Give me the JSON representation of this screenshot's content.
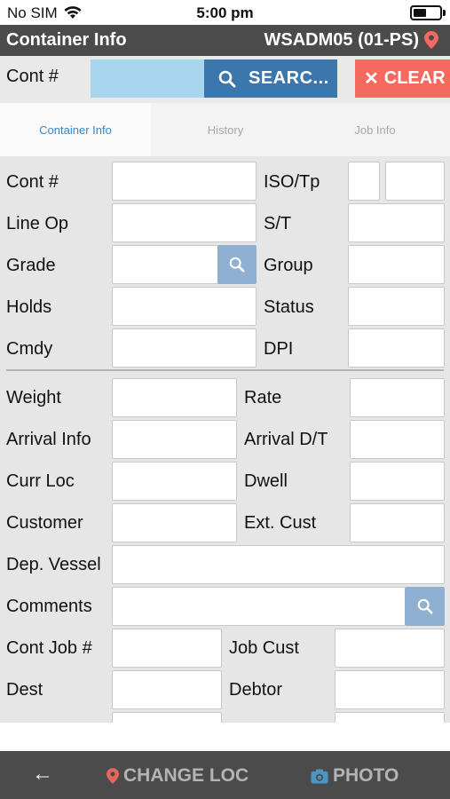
{
  "status_bar": {
    "carrier": "No SIM",
    "time": "5:00 pm"
  },
  "header": {
    "title": "Container Info",
    "location": "WSADM05 (01-PS)"
  },
  "search": {
    "label": "Cont #",
    "value": "",
    "search_label": "SEARC...",
    "clear_label": "CLEAR"
  },
  "tabs": [
    {
      "label": "Container Info"
    },
    {
      "label": "History"
    },
    {
      "label": "Job Info"
    }
  ],
  "form": {
    "cont_no": "Cont #",
    "iso_tp": "ISO/Tp",
    "line_op": "Line Op",
    "s_t": "S/T",
    "grade": "Grade",
    "group": "Group",
    "holds": "Holds",
    "status": "Status",
    "cmdy": "Cmdy",
    "dpi": "DPI",
    "weight": "Weight",
    "rate": "Rate",
    "arrival_info": "Arrival Info",
    "arrival_dt": "Arrival D/T",
    "curr_loc": "Curr Loc",
    "dwell": "Dwell",
    "customer": "Customer",
    "ext_cust": "Ext. Cust",
    "dep_vessel": "Dep. Vessel",
    "comments": "Comments",
    "cont_job_no": "Cont Job #",
    "job_cust": "Job Cust",
    "dest": "Dest",
    "debtor": "Debtor"
  },
  "footer": {
    "back_icon": "arrow-left-icon",
    "change_loc": "CHANGE LOC",
    "photo": "PHOTO"
  },
  "colors": {
    "header_bg": "#4b4b4b",
    "search_btn": "#3b77ac",
    "clear_btn": "#f46a5e",
    "active_tab": "#3b86c6",
    "pin": "#f46a5e"
  }
}
